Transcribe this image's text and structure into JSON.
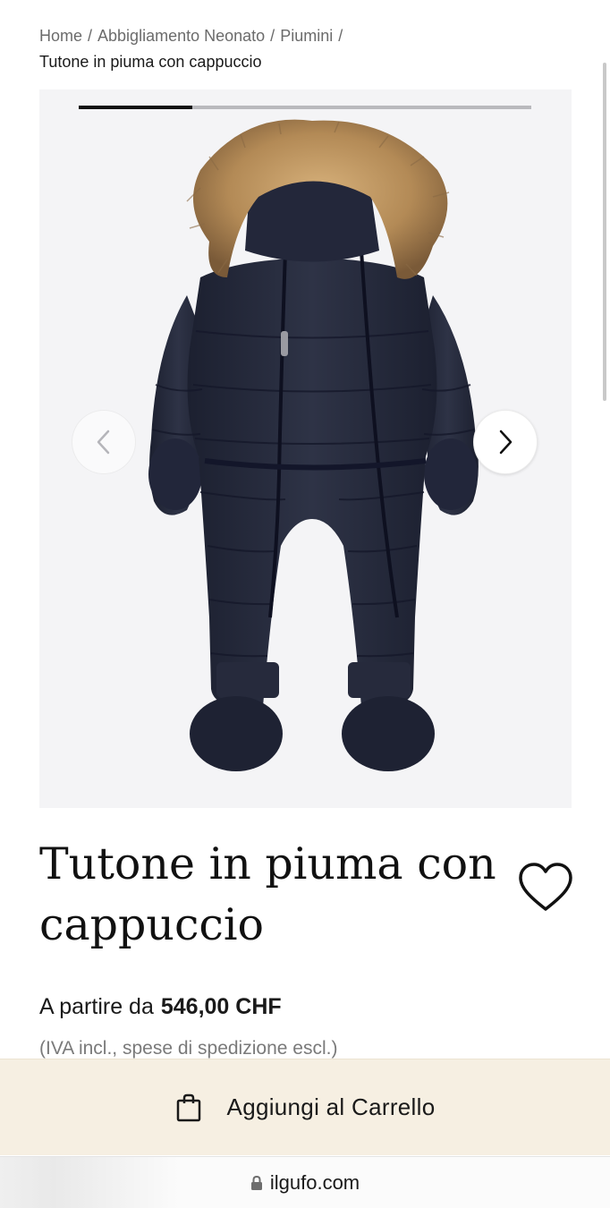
{
  "breadcrumb": {
    "items": [
      "Home",
      "Abbigliamento Neonato",
      "Piumini"
    ],
    "separator": "/",
    "current": "Tutone in piuma con cappuccio"
  },
  "gallery": {
    "progress_fraction": 0.25,
    "image": "navy-down-snowsuit-with-fur-hood"
  },
  "product": {
    "title_line1": "Tutone in piuma con",
    "title_line2": "cappuccio",
    "price_prefix": "A partire da",
    "price": "546,00 CHF",
    "tax_note": "(IVA incl., spese di spedizione escl.)"
  },
  "cart": {
    "label": "Aggiungi al Carrello",
    "background": "#f6efe2"
  },
  "browser": {
    "url": "ilgufo.com"
  },
  "colors": {
    "garment": "#262a3a",
    "fur": "#b8905c",
    "gallery_bg": "#f4f4f6"
  }
}
